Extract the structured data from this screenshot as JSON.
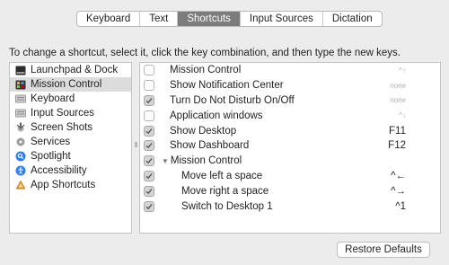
{
  "tabs": [
    {
      "label": "Keyboard",
      "active": false
    },
    {
      "label": "Text",
      "active": false
    },
    {
      "label": "Shortcuts",
      "active": true
    },
    {
      "label": "Input Sources",
      "active": false
    },
    {
      "label": "Dictation",
      "active": false
    }
  ],
  "instructions": "To change a shortcut, select it, click the key combination, and then type the new keys.",
  "categories": [
    {
      "label": "Launchpad & Dock",
      "icon": "launchpad-dock-icon",
      "selected": false
    },
    {
      "label": "Mission Control",
      "icon": "mission-control-icon",
      "selected": true
    },
    {
      "label": "Keyboard",
      "icon": "keyboard-icon",
      "selected": false
    },
    {
      "label": "Input Sources",
      "icon": "input-sources-icon",
      "selected": false
    },
    {
      "label": "Screen Shots",
      "icon": "screenshot-icon",
      "selected": false
    },
    {
      "label": "Services",
      "icon": "gear-icon",
      "selected": false
    },
    {
      "label": "Spotlight",
      "icon": "spotlight-icon",
      "selected": false
    },
    {
      "label": "Accessibility",
      "icon": "accessibility-icon",
      "selected": false
    },
    {
      "label": "App Shortcuts",
      "icon": "app-shortcuts-icon",
      "selected": false
    }
  ],
  "shortcuts": [
    {
      "label": "Mission Control",
      "key": "^↑",
      "checked": false,
      "indent": 0,
      "key_muted": true,
      "group": false
    },
    {
      "label": "Show Notification Center",
      "key": "none",
      "checked": false,
      "indent": 0,
      "key_muted": true,
      "group": false
    },
    {
      "label": "Turn Do Not Disturb On/Off",
      "key": "none",
      "checked": true,
      "indent": 0,
      "key_muted": true,
      "group": false
    },
    {
      "label": "Application windows",
      "key": "^↓",
      "checked": false,
      "indent": 0,
      "key_muted": true,
      "group": false
    },
    {
      "label": "Show Desktop",
      "key": "F11",
      "checked": true,
      "indent": 0,
      "key_muted": false,
      "group": false
    },
    {
      "label": "Show Dashboard",
      "key": "F12",
      "checked": true,
      "indent": 0,
      "key_muted": false,
      "group": false
    },
    {
      "label": "Mission Control",
      "key": "",
      "checked": true,
      "indent": 0,
      "key_muted": false,
      "group": true
    },
    {
      "label": "Move left a space",
      "key": "^←",
      "checked": true,
      "indent": 1,
      "key_muted": false,
      "group": false
    },
    {
      "label": "Move right a space",
      "key": "^→",
      "checked": true,
      "indent": 1,
      "key_muted": false,
      "group": false
    },
    {
      "label": "Switch to Desktop 1",
      "key": "^1",
      "checked": true,
      "indent": 1,
      "key_muted": false,
      "group": false
    }
  ],
  "restore_label": "Restore Defaults"
}
